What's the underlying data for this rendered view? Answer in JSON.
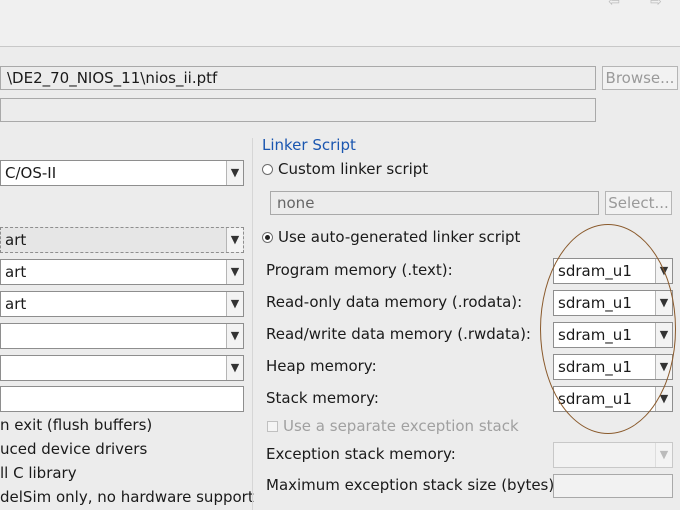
{
  "nav": {
    "back_icon": "back-arrow-icon",
    "forward_icon": "forward-arrow-icon"
  },
  "ptf_path": {
    "value": "\\DE2_70_NIOS_11\\nios_ii.ptf"
  },
  "browse_label": "Browse...",
  "left": {
    "os_combo": "C/OS-II",
    "combos": [
      "art",
      "art",
      "art",
      "",
      ""
    ],
    "textbox_value": "",
    "option_texts": [
      "n exit (flush buffers)",
      "uced device drivers",
      "ll C library",
      "delSim only, no hardware support"
    ]
  },
  "linker": {
    "title": "Linker Script",
    "custom_label": "Custom linker script",
    "custom_value": "none",
    "select_label": "Select...",
    "auto_label": "Use auto-generated linker script",
    "rows": [
      {
        "label": "Program memory (.text):",
        "value": "sdram_u1"
      },
      {
        "label": "Read-only data memory (.rodata):",
        "value": "sdram_u1"
      },
      {
        "label": "Read/write data memory (.rwdata):",
        "value": "sdram_u1"
      },
      {
        "label": "Heap memory:",
        "value": "sdram_u1"
      },
      {
        "label": "Stack memory:",
        "value": "sdram_u1"
      }
    ],
    "separate_exception_label": "Use a separate exception stack",
    "exception_memory_label": "Exception stack memory:",
    "exception_memory_value": "",
    "max_exception_label": "Maximum exception stack size (bytes):",
    "max_exception_value": ""
  },
  "colors": {
    "accent": "#1a56b0",
    "annotation": "#8a5a2c"
  }
}
